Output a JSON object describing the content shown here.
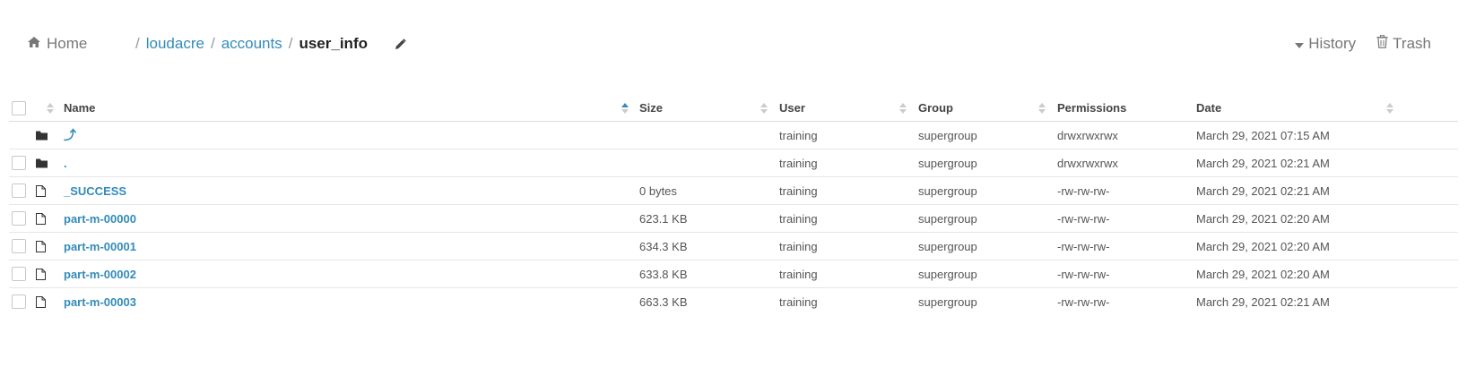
{
  "header": {
    "home_label": "Home",
    "breadcrumbs": [
      {
        "label": "loudacre"
      },
      {
        "label": "accounts"
      }
    ],
    "current": "user_info",
    "separator": "/",
    "history_label": "History",
    "trash_label": "Trash"
  },
  "table": {
    "columns": {
      "name": "Name",
      "size": "Size",
      "user": "User",
      "group": "Group",
      "permissions": "Permissions",
      "date": "Date"
    },
    "sorted_column": "Name",
    "sort_direction": "ascending",
    "rows": [
      {
        "type": "folder",
        "name": "⤴",
        "size": "",
        "user": "training",
        "group": "supergroup",
        "permissions": "drwxrwxrwx",
        "date": "March 29, 2021 07:15 AM"
      },
      {
        "type": "folder",
        "name": ".",
        "size": "",
        "user": "training",
        "group": "supergroup",
        "permissions": "drwxrwxrwx",
        "date": "March 29, 2021 02:21 AM"
      },
      {
        "type": "file",
        "name": "_SUCCESS",
        "size": "0 bytes",
        "user": "training",
        "group": "supergroup",
        "permissions": "-rw-rw-rw-",
        "date": "March 29, 2021 02:21 AM"
      },
      {
        "type": "file",
        "name": "part-m-00000",
        "size": "623.1 KB",
        "user": "training",
        "group": "supergroup",
        "permissions": "-rw-rw-rw-",
        "date": "March 29, 2021 02:20 AM"
      },
      {
        "type": "file",
        "name": "part-m-00001",
        "size": "634.3 KB",
        "user": "training",
        "group": "supergroup",
        "permissions": "-rw-rw-rw-",
        "date": "March 29, 2021 02:20 AM"
      },
      {
        "type": "file",
        "name": "part-m-00002",
        "size": "633.8 KB",
        "user": "training",
        "group": "supergroup",
        "permissions": "-rw-rw-rw-",
        "date": "March 29, 2021 02:20 AM"
      },
      {
        "type": "file",
        "name": "part-m-00003",
        "size": "663.3 KB",
        "user": "training",
        "group": "supergroup",
        "permissions": "-rw-rw-rw-",
        "date": "March 29, 2021 02:21 AM"
      }
    ]
  },
  "colors": {
    "link": "#338bb8",
    "muted": "#777777",
    "sort_active": "#338bb8",
    "sort_inactive": "#cccccc"
  },
  "icons": {
    "home": "home-icon",
    "edit": "pencil-icon",
    "history": "caret-down-icon",
    "trash": "trash-icon",
    "folder": "folder-icon",
    "file": "file-icon"
  }
}
